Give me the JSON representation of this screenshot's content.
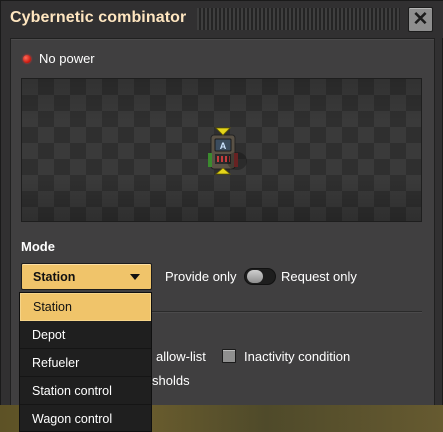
{
  "window": {
    "title": "Cybernetic combinator"
  },
  "status": {
    "text": "No power",
    "color": "#e0281b"
  },
  "mode": {
    "label": "Mode",
    "selected": "Station",
    "options": [
      "Station",
      "Depot",
      "Refueler",
      "Station control",
      "Wagon control"
    ],
    "provide_label": "Provide only",
    "request_label": "Request only"
  },
  "partial": {
    "allow_list": "allow-list",
    "inactivity": "Inactivity condition",
    "thresholds": "sholds"
  },
  "colors": {
    "accent": "#f0c46a",
    "title": "#ffe6c0",
    "panel": "#403f40"
  },
  "icons": {
    "close": "close-icon",
    "combinator": "combinator-entity-icon"
  }
}
